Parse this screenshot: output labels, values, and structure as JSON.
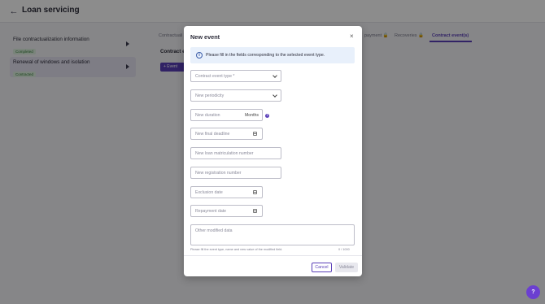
{
  "page": {
    "title": "Loan servicing",
    "back_icon": "←"
  },
  "sidebar": {
    "items": [
      {
        "title": "File contractualization information",
        "status": "Completed"
      },
      {
        "title": "Renewal of windows and isolation",
        "status": "Contracted"
      }
    ]
  },
  "tabs": [
    {
      "label": "Contractuali"
    },
    {
      "label": "payment 🔒"
    },
    {
      "label": "Recoveries 🔒"
    },
    {
      "label": "Contract event(s)"
    }
  ],
  "main": {
    "section_label": "Contract e",
    "event_button": "+ Event"
  },
  "modal": {
    "title": "New event",
    "close_icon": "×",
    "info_icon": "i",
    "info_text": "Please fill in the fields corresponding to the selected event type.",
    "fields": {
      "contract_event_type": "Contract event type *",
      "new_periodicity": "New periodicity",
      "new_duration": "New duration",
      "duration_unit": "Months",
      "help_icon": "?",
      "new_final_deadline": "New final deadline",
      "new_matriculation": "New loan matriculation number",
      "new_registration": "New registration number",
      "exclusion_date": "Exclusion date",
      "repayment_date": "Repayment date",
      "other_modified_data": "Other modified data"
    },
    "helper_text": "Please fill the event type, name and new value of the modified field.",
    "counter": "0 / 1000",
    "cancel_label": "Cancel",
    "validate_label": "Validate"
  },
  "help_fab": "?",
  "colors": {
    "accent": "#5a3fb8",
    "info_bg": "#e8f0fb",
    "fab": "#6b3fd1"
  }
}
